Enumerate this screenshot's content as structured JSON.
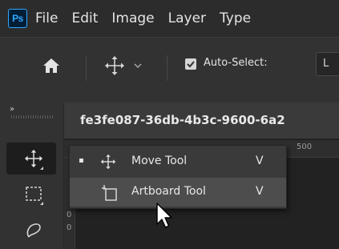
{
  "app": {
    "logo_text": "Ps",
    "accent_color": "#31a8ff"
  },
  "menubar": {
    "items": [
      "File",
      "Edit",
      "Image",
      "Layer",
      "Type"
    ]
  },
  "options_bar": {
    "home_icon": "home-icon",
    "move_icon": "move-icon",
    "auto_select_checked": true,
    "auto_select_label": "Auto-Select:",
    "dropdown_text": "L"
  },
  "toolbar": {
    "expand_label": "»",
    "tools": [
      {
        "name": "move-tool",
        "icon": "move-icon",
        "active": true
      },
      {
        "name": "marquee-tool",
        "icon": "rect-marquee-icon",
        "active": false
      },
      {
        "name": "lasso-tool",
        "icon": "lasso-icon",
        "active": false
      }
    ]
  },
  "document": {
    "tab_title": "fe3fe087-36db-4b3c-9600-6a2"
  },
  "rulers": {
    "top_label": "500",
    "left_labels": [
      "0",
      "0"
    ]
  },
  "flyout": {
    "items": [
      {
        "label": "Move Tool",
        "shortcut": "V",
        "icon": "move-icon",
        "selected": true
      },
      {
        "label": "Artboard Tool",
        "shortcut": "V",
        "icon": "artboard-icon",
        "selected": false,
        "hovered": true
      }
    ]
  }
}
